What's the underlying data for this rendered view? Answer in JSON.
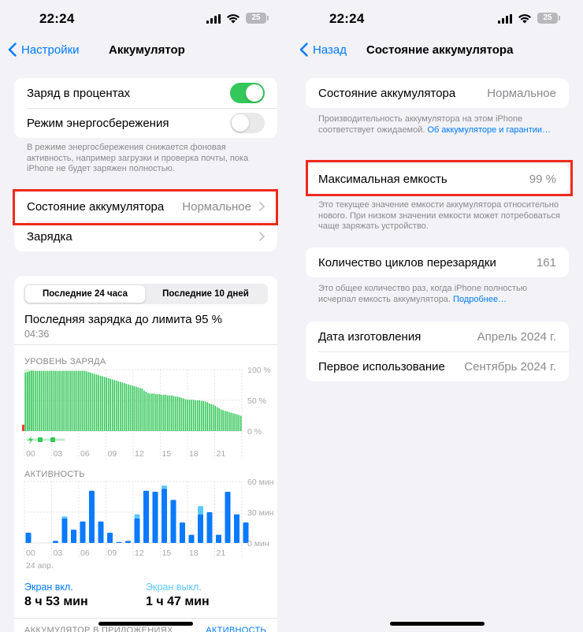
{
  "status_bar": {
    "time": "22:24",
    "battery": "25"
  },
  "left": {
    "nav": {
      "back_label": "Настройки",
      "title": "Аккумулятор"
    },
    "settings": {
      "percent_label": "Заряд в процентах",
      "percent_on": true,
      "low_power_label": "Режим энергосбережения",
      "low_power_on": false,
      "low_power_footer": "В режиме энергосбережения снижается фоновая активность, например загрузки и проверка почты, пока iPhone не будет заряжен полностью."
    },
    "health_row": {
      "label": "Состояние аккумулятора",
      "value": "Нормальное"
    },
    "charging_row": {
      "label": "Зарядка"
    },
    "tabs": [
      "Последние 24 часа",
      "Последние 10 дней"
    ],
    "selected_tab": 0,
    "last_charge": {
      "title": "Последняя зарядка до лимита 95 %",
      "time": "04:36"
    },
    "battery_chart_label": "УРОВЕНЬ ЗАРЯДА",
    "activity_chart_label": "АКТИВНОСТЬ",
    "date_label": "24 апр.",
    "screen_on": {
      "label": "Экран вкл.",
      "value": "8 ч 53 мин"
    },
    "screen_off": {
      "label": "Экран выкл.",
      "value": "1 ч 47 мин"
    },
    "bottom_cut_label": "АККУМУЛЯТОР В ПРИЛОЖЕНИЯХ",
    "bottom_cut_link": "АКТИВНОСТЬ"
  },
  "right": {
    "nav": {
      "back_label": "Назад",
      "title": "Состояние аккумулятора"
    },
    "health": {
      "label": "Состояние аккумулятора",
      "value": "Нормальное"
    },
    "health_footer": "Производительность аккумулятора на этом iPhone соответствует ожидаемой.",
    "health_footer_link": "Об аккумуляторе и гарантии…",
    "capacity": {
      "label": "Максимальная емкость",
      "value": "99 %"
    },
    "capacity_footer": "Это текущее значение емкости аккумулятора относительно нового. При низком значении емкости может потребоваться чаще заряжать устройство.",
    "cycles": {
      "label": "Количество циклов перезарядки",
      "value": "161"
    },
    "cycles_footer": "Это общее количество раз, когда iPhone полностью исчерпал емкость аккумулятора.",
    "cycles_footer_link": "Подробнее…",
    "manufacture": {
      "label": "Дата изготовления",
      "value": "Апрель 2024 г."
    },
    "first_use": {
      "label": "Первое использование",
      "value": "Сентябрь 2024 г."
    }
  },
  "colors": {
    "accent": "#007aff",
    "green": "#34c759",
    "highlight": "#ee2a1c",
    "activity_on": "#0a7aff",
    "activity_off": "#5ac8fa"
  },
  "chart_data": [
    {
      "type": "bar",
      "title": "УРОВЕНЬ ЗАРЯДА",
      "x_ticks": [
        "00",
        "03",
        "06",
        "09",
        "12",
        "15",
        "18",
        "21"
      ],
      "y_ticks": [
        "100 %",
        "50 %",
        "0 %"
      ],
      "ylim": [
        0,
        100
      ],
      "values": [
        95,
        96,
        97,
        98,
        98,
        98,
        98,
        98,
        98,
        98,
        98,
        98,
        98,
        98,
        98,
        98,
        98,
        98,
        98,
        98,
        98,
        98,
        98,
        98,
        98,
        98,
        98,
        98,
        98,
        98,
        98,
        97,
        96,
        95,
        94,
        93,
        92,
        91,
        90,
        89,
        88,
        87,
        86,
        85,
        84,
        83,
        82,
        81,
        80,
        79,
        78,
        77,
        76,
        75,
        74,
        73,
        72,
        71,
        70,
        69,
        66,
        64,
        62,
        61,
        61,
        61,
        60,
        60,
        60,
        59,
        59,
        59,
        58,
        58,
        58,
        57,
        56,
        56,
        55,
        54,
        53,
        52,
        51,
        51,
        51,
        51,
        50,
        50,
        50,
        49,
        49,
        48,
        47,
        45,
        44,
        43,
        41,
        39,
        37,
        35,
        34,
        33,
        32,
        31,
        30,
        29,
        28,
        27,
        26,
        25
      ],
      "charging_hours": [
        0,
        1
      ]
    },
    {
      "type": "bar",
      "title": "АКТИВНОСТЬ",
      "x_ticks": [
        "00",
        "03",
        "06",
        "09",
        "12",
        "15",
        "18",
        "21"
      ],
      "y_ticks": [
        "60 мин",
        "30 мин",
        "0 мин"
      ],
      "ylim": [
        0,
        60
      ],
      "series": [
        {
          "name": "Экран вкл.",
          "values": [
            10,
            0,
            0,
            2,
            24,
            13,
            21,
            51,
            21,
            10,
            1,
            2,
            24,
            51,
            50,
            53,
            42,
            20,
            8,
            28,
            30,
            8,
            50,
            28,
            20
          ]
        },
        {
          "name": "Экран выкл.",
          "values": [
            0,
            0,
            0,
            0,
            2,
            0,
            0,
            0,
            0,
            0,
            0,
            0,
            4,
            0,
            0,
            3,
            0,
            0,
            0,
            8,
            0,
            0,
            0,
            0,
            0
          ]
        }
      ]
    }
  ]
}
